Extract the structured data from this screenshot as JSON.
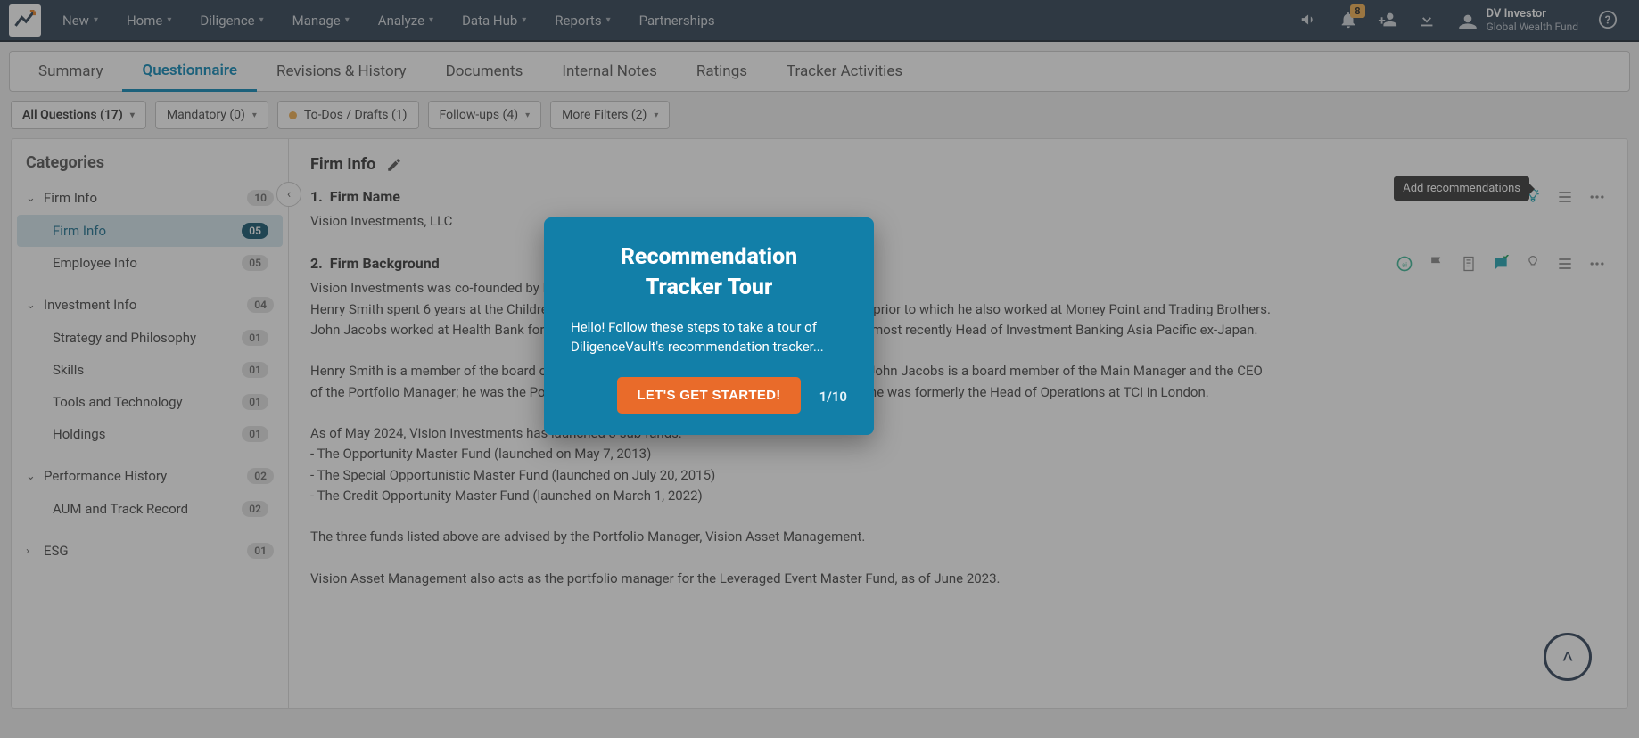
{
  "topbar": {
    "nav": [
      "New",
      "Home",
      "Diligence",
      "Manage",
      "Analyze",
      "Data Hub",
      "Reports",
      "Partnerships"
    ],
    "notification_badge": "8",
    "user_name": "DV Investor",
    "user_sub": "Global Wealth Fund"
  },
  "tabs": [
    "Summary",
    "Questionnaire",
    "Revisions & History",
    "Documents",
    "Internal Notes",
    "Ratings",
    "Tracker Activities"
  ],
  "active_tab_index": 1,
  "filters": {
    "all_questions": "All Questions (17)",
    "mandatory": "Mandatory (0)",
    "todos": "To-Dos / Drafts (1)",
    "followups": "Follow-ups (4)",
    "more": "More Filters (2)"
  },
  "sidebar": {
    "heading": "Categories",
    "sections": [
      {
        "label": "Firm Info",
        "count": "10",
        "expanded": true,
        "subs": [
          {
            "label": "Firm Info",
            "count": "05",
            "active": true
          },
          {
            "label": "Employee Info",
            "count": "05",
            "active": false
          }
        ]
      },
      {
        "label": "Investment Info",
        "count": "04",
        "expanded": true,
        "subs": [
          {
            "label": "Strategy and Philosophy",
            "count": "01"
          },
          {
            "label": "Skills",
            "count": "01"
          },
          {
            "label": "Tools and Technology",
            "count": "01"
          },
          {
            "label": "Holdings",
            "count": "01"
          }
        ]
      },
      {
        "label": "Performance History",
        "count": "02",
        "expanded": true,
        "subs": [
          {
            "label": "AUM and Track Record",
            "count": "02"
          }
        ]
      },
      {
        "label": "ESG",
        "count": "01",
        "expanded": false,
        "subs": []
      }
    ]
  },
  "content": {
    "section_title": "Firm Info",
    "tooltip_text": "Add recommendations",
    "q1": {
      "num": "1.",
      "title": "Firm Name",
      "answer": "Vision Investments, LLC"
    },
    "q2": {
      "num": "2.",
      "title": "Firm Background",
      "p1": "Vision Investments was co-founded by Henry Smith and John Jacobs.",
      "p2": "Henry Smith spent 6 years at the Children's Investment Fund as a Portfolio Manager in London, prior to which he also worked at Money Point and Trading Brothers.",
      "p3": "John Jacobs worked at Health Bank for 11 years in Los Angeles and Hong Kong where he was most recently Head of Investment Banking Asia Pacific ex-Japan.",
      "p4": "Henry Smith is a member of the board of Main Manager and the CIO of the Portfolio Manager. John Jacobs is a board member of the Main Manager and the CEO of the Portfolio Manager; he was the Portfolio Manager at launch and is the firm's COO & CCO; he was formerly the Head of Operations at TCI in London.",
      "p5": "As of May 2024, Vision Investments has launched 3 sub funds:",
      "p6": "- The Opportunity Master Fund (launched on May 7, 2013)",
      "p7": "- The Special Opportunistic Master Fund (launched on July 20, 2015)",
      "p8": "- The Credit Opportunity Master Fund (launched on March 1, 2022)",
      "p9": "The three funds listed above are advised by the Portfolio Manager, Vision Asset Management.",
      "p10": "Vision Asset Management also acts as the portfolio manager for the Leveraged Event Master Fund, as of June 2023."
    }
  },
  "tour": {
    "title_line1": "Recommendation",
    "title_line2": "Tracker Tour",
    "body": "Hello! Follow these steps to take a tour of DiligenceVault's recommendation tracker...",
    "button": "LET'S GET STARTED!",
    "step": "1/10"
  }
}
